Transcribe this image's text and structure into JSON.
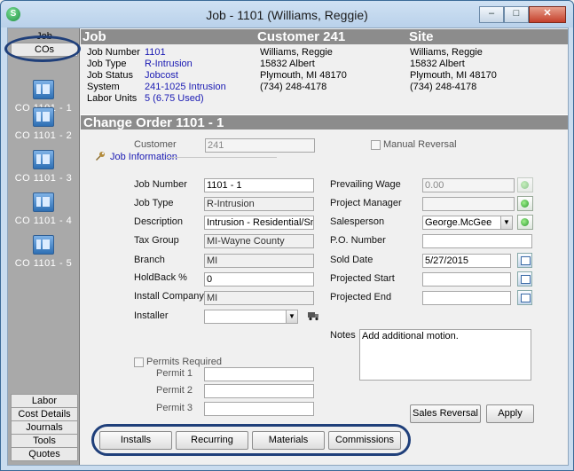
{
  "window": {
    "title": "Job - 1101 (Williams, Reggie)",
    "app_icon": "S"
  },
  "sidebar": {
    "job_tab": "Job",
    "cos_tab": "COs",
    "change_orders": [
      "CO 1101 - 1",
      "CO 1101 - 2",
      "CO 1101 - 3",
      "CO 1101 - 4",
      "CO 1101 - 5"
    ],
    "bottom_tabs": [
      "Labor",
      "Cost Details",
      "Journals",
      "Tools",
      "Quotes"
    ]
  },
  "header": {
    "job_title": "Job",
    "customer_title": "Customer 241",
    "site_title": "Site",
    "job": {
      "number_label": "Job Number",
      "number": "1101",
      "type_label": "Job Type",
      "type": "R-Intrusion",
      "status_label": "Job Status",
      "status": "Jobcost",
      "system_label": "System",
      "system": "241-1025 Intrusion",
      "labor_label": "Labor Units",
      "labor": "5 (6.75 Used)"
    },
    "customer": {
      "name": "Williams, Reggie",
      "street": "15832 Albert",
      "city": "Plymouth, MI 48170",
      "phone": "(734) 248-4178"
    },
    "site": {
      "name": "Williams, Reggie",
      "street": "15832 Albert",
      "city": "Plymouth, MI 48170",
      "phone": "(734) 248-4178"
    }
  },
  "change_order": {
    "title": "Change Order 1101 - 1",
    "customer_label": "Customer",
    "customer_value": "241",
    "manual_reversal_label": "Manual Reversal",
    "job_info_link": "Job Information",
    "left_fields": {
      "job_number_label": "Job Number",
      "job_number": "1101 - 1",
      "job_type_label": "Job Type",
      "job_type": "R-Intrusion",
      "description_label": "Description",
      "description": "Intrusion - Residential/Small Co",
      "tax_group_label": "Tax Group",
      "tax_group": "MI-Wayne County",
      "branch_label": "Branch",
      "branch": "MI",
      "holdback_label": "HoldBack  %",
      "holdback": "0",
      "install_company_label": "Install Company",
      "install_company": "MI",
      "installer_label": "Installer",
      "installer": ""
    },
    "right_fields": {
      "prevailing_wage_label": "Prevailing Wage",
      "prevailing_wage": "0.00",
      "project_manager_label": "Project Manager",
      "project_manager": "",
      "salesperson_label": "Salesperson",
      "salesperson": "George.McGee",
      "po_number_label": "P.O. Number",
      "po_number": "",
      "sold_date_label": "Sold Date",
      "sold_date": "5/27/2015",
      "projected_start_label": "Projected Start",
      "projected_start": "",
      "projected_end_label": "Projected End",
      "projected_end": ""
    },
    "permits": {
      "required_label": "Permits Required",
      "permit1_label": "Permit 1",
      "permit2_label": "Permit 2",
      "permit3_label": "Permit 3"
    },
    "notes_label": "Notes",
    "notes": "Add additional motion.",
    "buttons": {
      "sales_reversal": "Sales Reversal",
      "apply": "Apply",
      "installs": "Installs",
      "recurring": "Recurring",
      "materials": "Materials",
      "commissions": "Commissions"
    }
  }
}
